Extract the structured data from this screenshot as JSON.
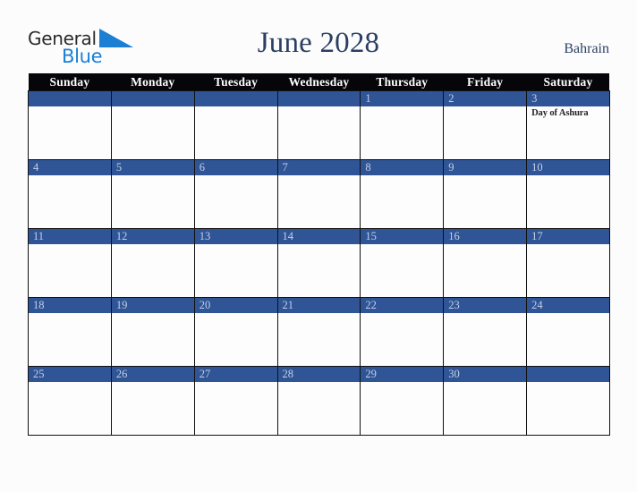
{
  "brand": {
    "name_part1": "General",
    "name_part2": "Blue",
    "triangle_icon": "triangle-icon",
    "color_dark": "#2b2b2b",
    "color_blue": "#1b7fd4"
  },
  "header": {
    "title": "June 2028",
    "country": "Bahrain",
    "title_color": "#2b3f63"
  },
  "calendar": {
    "month": "June",
    "year": "2028",
    "weekday_headers": [
      "Sunday",
      "Monday",
      "Tuesday",
      "Wednesday",
      "Thursday",
      "Friday",
      "Saturday"
    ],
    "colors": {
      "header_bg": "#05050a",
      "header_text": "#ffffff",
      "band_bg": "#2f5597",
      "band_text": "#c5cfe3",
      "cell_bg": "#fdfdfd",
      "border": "#111111",
      "page_bg": "#fcfcfd"
    },
    "weeks": [
      {
        "days": [
          {
            "date": "",
            "holiday": ""
          },
          {
            "date": "",
            "holiday": ""
          },
          {
            "date": "",
            "holiday": ""
          },
          {
            "date": "",
            "holiday": ""
          },
          {
            "date": "1",
            "holiday": ""
          },
          {
            "date": "2",
            "holiday": ""
          },
          {
            "date": "3",
            "holiday": "Day of Ashura"
          }
        ]
      },
      {
        "days": [
          {
            "date": "4",
            "holiday": ""
          },
          {
            "date": "5",
            "holiday": ""
          },
          {
            "date": "6",
            "holiday": ""
          },
          {
            "date": "7",
            "holiday": ""
          },
          {
            "date": "8",
            "holiday": ""
          },
          {
            "date": "9",
            "holiday": ""
          },
          {
            "date": "10",
            "holiday": ""
          }
        ]
      },
      {
        "days": [
          {
            "date": "11",
            "holiday": ""
          },
          {
            "date": "12",
            "holiday": ""
          },
          {
            "date": "13",
            "holiday": ""
          },
          {
            "date": "14",
            "holiday": ""
          },
          {
            "date": "15",
            "holiday": ""
          },
          {
            "date": "16",
            "holiday": ""
          },
          {
            "date": "17",
            "holiday": ""
          }
        ]
      },
      {
        "days": [
          {
            "date": "18",
            "holiday": ""
          },
          {
            "date": "19",
            "holiday": ""
          },
          {
            "date": "20",
            "holiday": ""
          },
          {
            "date": "21",
            "holiday": ""
          },
          {
            "date": "22",
            "holiday": ""
          },
          {
            "date": "23",
            "holiday": ""
          },
          {
            "date": "24",
            "holiday": ""
          }
        ]
      },
      {
        "days": [
          {
            "date": "25",
            "holiday": ""
          },
          {
            "date": "26",
            "holiday": ""
          },
          {
            "date": "27",
            "holiday": ""
          },
          {
            "date": "28",
            "holiday": ""
          },
          {
            "date": "29",
            "holiday": ""
          },
          {
            "date": "30",
            "holiday": ""
          },
          {
            "date": "",
            "holiday": ""
          }
        ]
      }
    ]
  }
}
